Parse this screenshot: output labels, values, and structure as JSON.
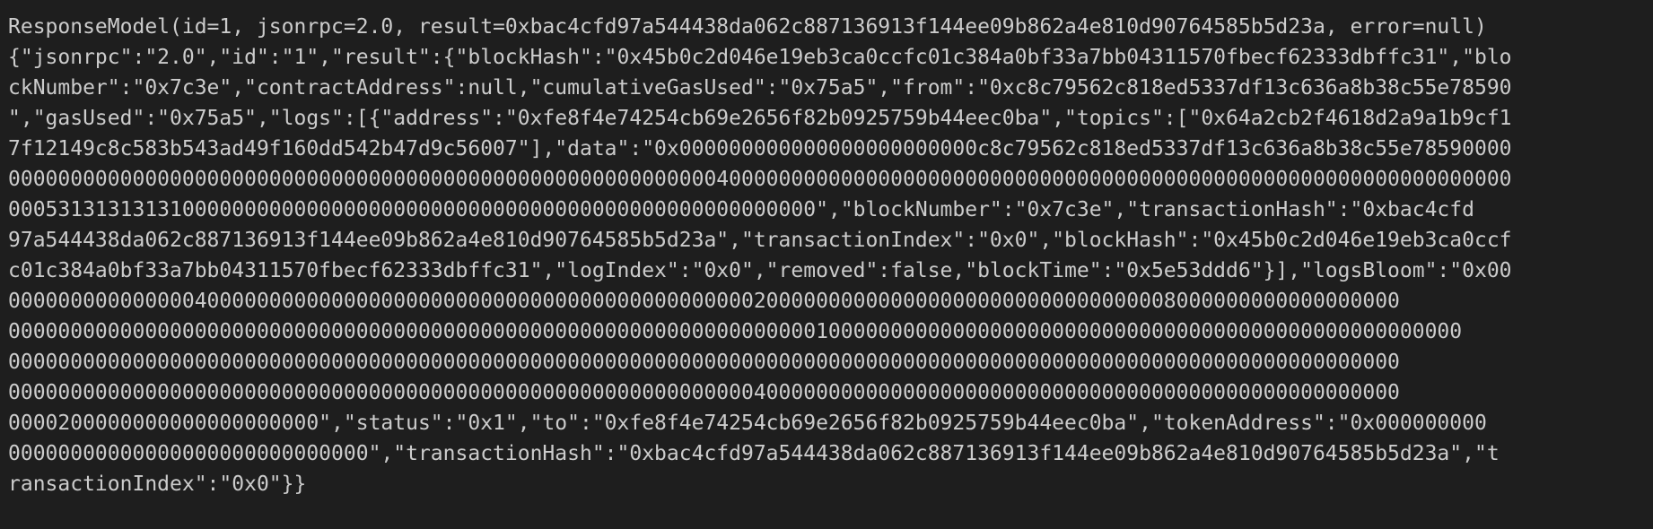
{
  "terminal": {
    "lines": [
      "ResponseModel(id=1, jsonrpc=2.0, result=0xbac4cfd97a544438da062c887136913f144ee09b862a4e810d90764585b5d23a, error=null)",
      "{\"jsonrpc\":\"2.0\",\"id\":\"1\",\"result\":{\"blockHash\":\"0x45b0c2d046e19eb3ca0ccfc01c384a0bf33a7bb04311570fbecf62333dbffc31\",\"blo",
      "ckNumber\":\"0x7c3e\",\"contractAddress\":null,\"cumulativeGasUsed\":\"0x75a5\",\"from\":\"0xc8c79562c818ed5337df13c636a8b38c55e78590",
      "\",\"gasUsed\":\"0x75a5\",\"logs\":[{\"address\":\"0xfe8f4e74254cb69e2656f82b0925759b44eec0ba\",\"topics\":[\"0x64a2cb2f4618d2a9a1b9cf1",
      "7f12149c8c583b543ad49f160dd542b47d9c56007\"],\"data\":\"0x000000000000000000000000c8c79562c818ed5337df13c636a8b38c55e78590000",
      "0000000000000000000000000000000000000000000000000000000004000000000000000000000000000000000000000000000000000000000000000",
      "00053131313131000000000000000000000000000000000000000000000000000\",\"blockNumber\":\"0x7c3e\",\"transactionHash\":\"0xbac4cfd",
      "97a544438da062c887136913f144ee09b862a4e810d90764585b5d23a\",\"transactionIndex\":\"0x0\",\"blockHash\":\"0x45b0c2d046e19eb3ca0ccf",
      "c01c384a0bf33a7bb04311570fbecf62333dbffc31\",\"logIndex\":\"0x0\",\"removed\":false,\"blockTime\":\"0x5e53ddd6\"}],\"logsBloom\":\"0x00",
      "0000000000000004000000000000000000000000000000000000000000002000000000000000000000000000000008000000000000000000",
      "000000000000000000000000000000000000000000000000000000000000000001000000000000000000000000000000000000000000000000000",
      "0000000000000000000000000000000000000000000000000000000000000000000000000000000000000000000000000000000000000000",
      "0000000000000000000000000000000000000000000000000000000000004000000000000000000000000000000000000000000000000000",
      "0000200000000000000000000\",\"status\":\"0x1\",\"to\":\"0xfe8f4e74254cb69e2656f82b0925759b44eec0ba\",\"tokenAddress\":\"0x000000000",
      "00000000000000000000000000000\",\"transactionHash\":\"0xbac4cfd97a544438da062c887136913f144ee09b862a4e810d90764585b5d23a\",\"t",
      "ransactionIndex\":\"0x0\"}}"
    ]
  },
  "colors": {
    "background": "#1e1e1e",
    "foreground": "#cccccc"
  }
}
